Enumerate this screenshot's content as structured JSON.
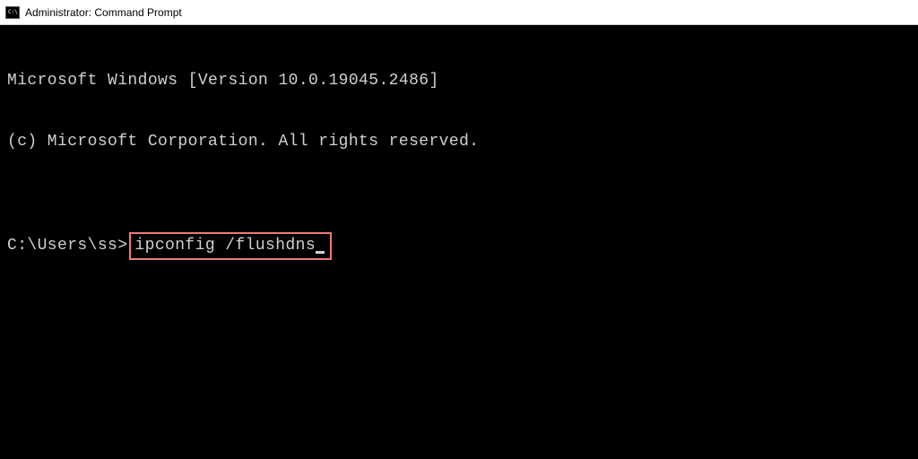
{
  "titlebar": {
    "title": "Administrator: Command Prompt"
  },
  "terminal": {
    "line1": "Microsoft Windows [Version 10.0.19045.2486]",
    "line2": "(c) Microsoft Corporation. All rights reserved.",
    "blank": "",
    "prompt": "C:\\Users\\ss>",
    "command": "ipconfig /flushdns"
  }
}
